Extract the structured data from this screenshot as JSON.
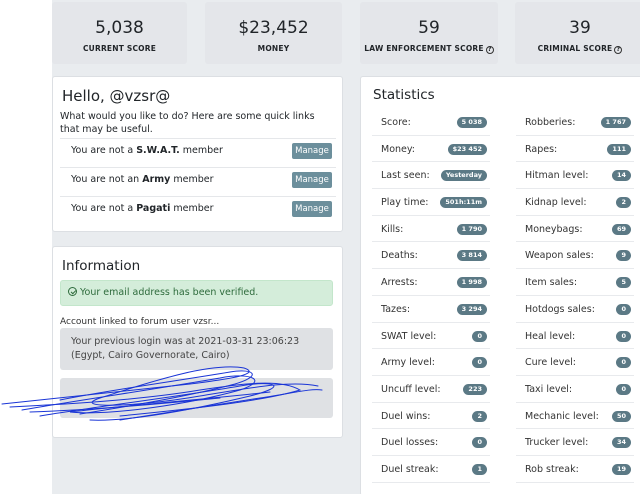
{
  "scores": [
    {
      "value": "5,038",
      "label": "CURRENT SCORE",
      "help": false
    },
    {
      "value": "$23,452",
      "label": "MONEY",
      "help": false
    },
    {
      "value": "59",
      "label": "LAW ENFORCEMENT SCORE",
      "help": true
    },
    {
      "value": "39",
      "label": "CRIMINAL SCORE",
      "help": true
    }
  ],
  "hello": {
    "title": "Hello, @vzsr@",
    "intro": "What would you like to do? Here are some quick links that may be useful.",
    "rows": [
      {
        "prefix": "You are not a ",
        "bold": "S.W.A.T.",
        "suffix": " member",
        "button": "Manage"
      },
      {
        "prefix": "You are not an ",
        "bold": "Army",
        "suffix": " member",
        "button": "Manage"
      },
      {
        "prefix": "You are not a ",
        "bold": "Pagati",
        "suffix": " member",
        "button": "Manage"
      }
    ]
  },
  "info": {
    "title": "Information",
    "verified": "Your email address has been verified.",
    "linked": "Account linked to forum user vzsr...",
    "last_login": "Your previous login was at 2021-03-31 23:06:23 (Egypt, Cairo Governorate, Cairo)"
  },
  "stats": {
    "title": "Statistics",
    "left": [
      {
        "k": "Score:",
        "v": "5 038"
      },
      {
        "k": "Money:",
        "v": "$23 452"
      },
      {
        "k": "Last seen:",
        "v": "Yesterday"
      },
      {
        "k": "Play time:",
        "v": "501h:11m"
      },
      {
        "k": "Kills:",
        "v": "1 790"
      },
      {
        "k": "Deaths:",
        "v": "3 814"
      },
      {
        "k": "Arrests:",
        "v": "1 998"
      },
      {
        "k": "Tazes:",
        "v": "3 294"
      },
      {
        "k": "SWAT level:",
        "v": "0"
      },
      {
        "k": "Army level:",
        "v": "0"
      },
      {
        "k": "Uncuff level:",
        "v": "223"
      },
      {
        "k": "Duel wins:",
        "v": "2"
      },
      {
        "k": "Duel losses:",
        "v": "0"
      },
      {
        "k": "Duel streak:",
        "v": "1"
      }
    ],
    "right": [
      {
        "k": "Robberies:",
        "v": "1 767"
      },
      {
        "k": "Rapes:",
        "v": "111"
      },
      {
        "k": "Hitman level:",
        "v": "14"
      },
      {
        "k": "Kidnap level:",
        "v": "2"
      },
      {
        "k": "Moneybags:",
        "v": "69"
      },
      {
        "k": "Weapon sales:",
        "v": "9"
      },
      {
        "k": "Item sales:",
        "v": "5"
      },
      {
        "k": "Hotdogs sales:",
        "v": "0"
      },
      {
        "k": "Heal level:",
        "v": "0"
      },
      {
        "k": "Cure level:",
        "v": "0"
      },
      {
        "k": "Taxi level:",
        "v": "0"
      },
      {
        "k": "Mechanic level:",
        "v": "50"
      },
      {
        "k": "Trucker level:",
        "v": "34"
      },
      {
        "k": "Rob streak:",
        "v": "19"
      }
    ]
  },
  "colors": {
    "pill": "#5b7985",
    "button": "#6c8f9c",
    "success_bg": "#d4edda",
    "scribble": "#1a35d6"
  }
}
